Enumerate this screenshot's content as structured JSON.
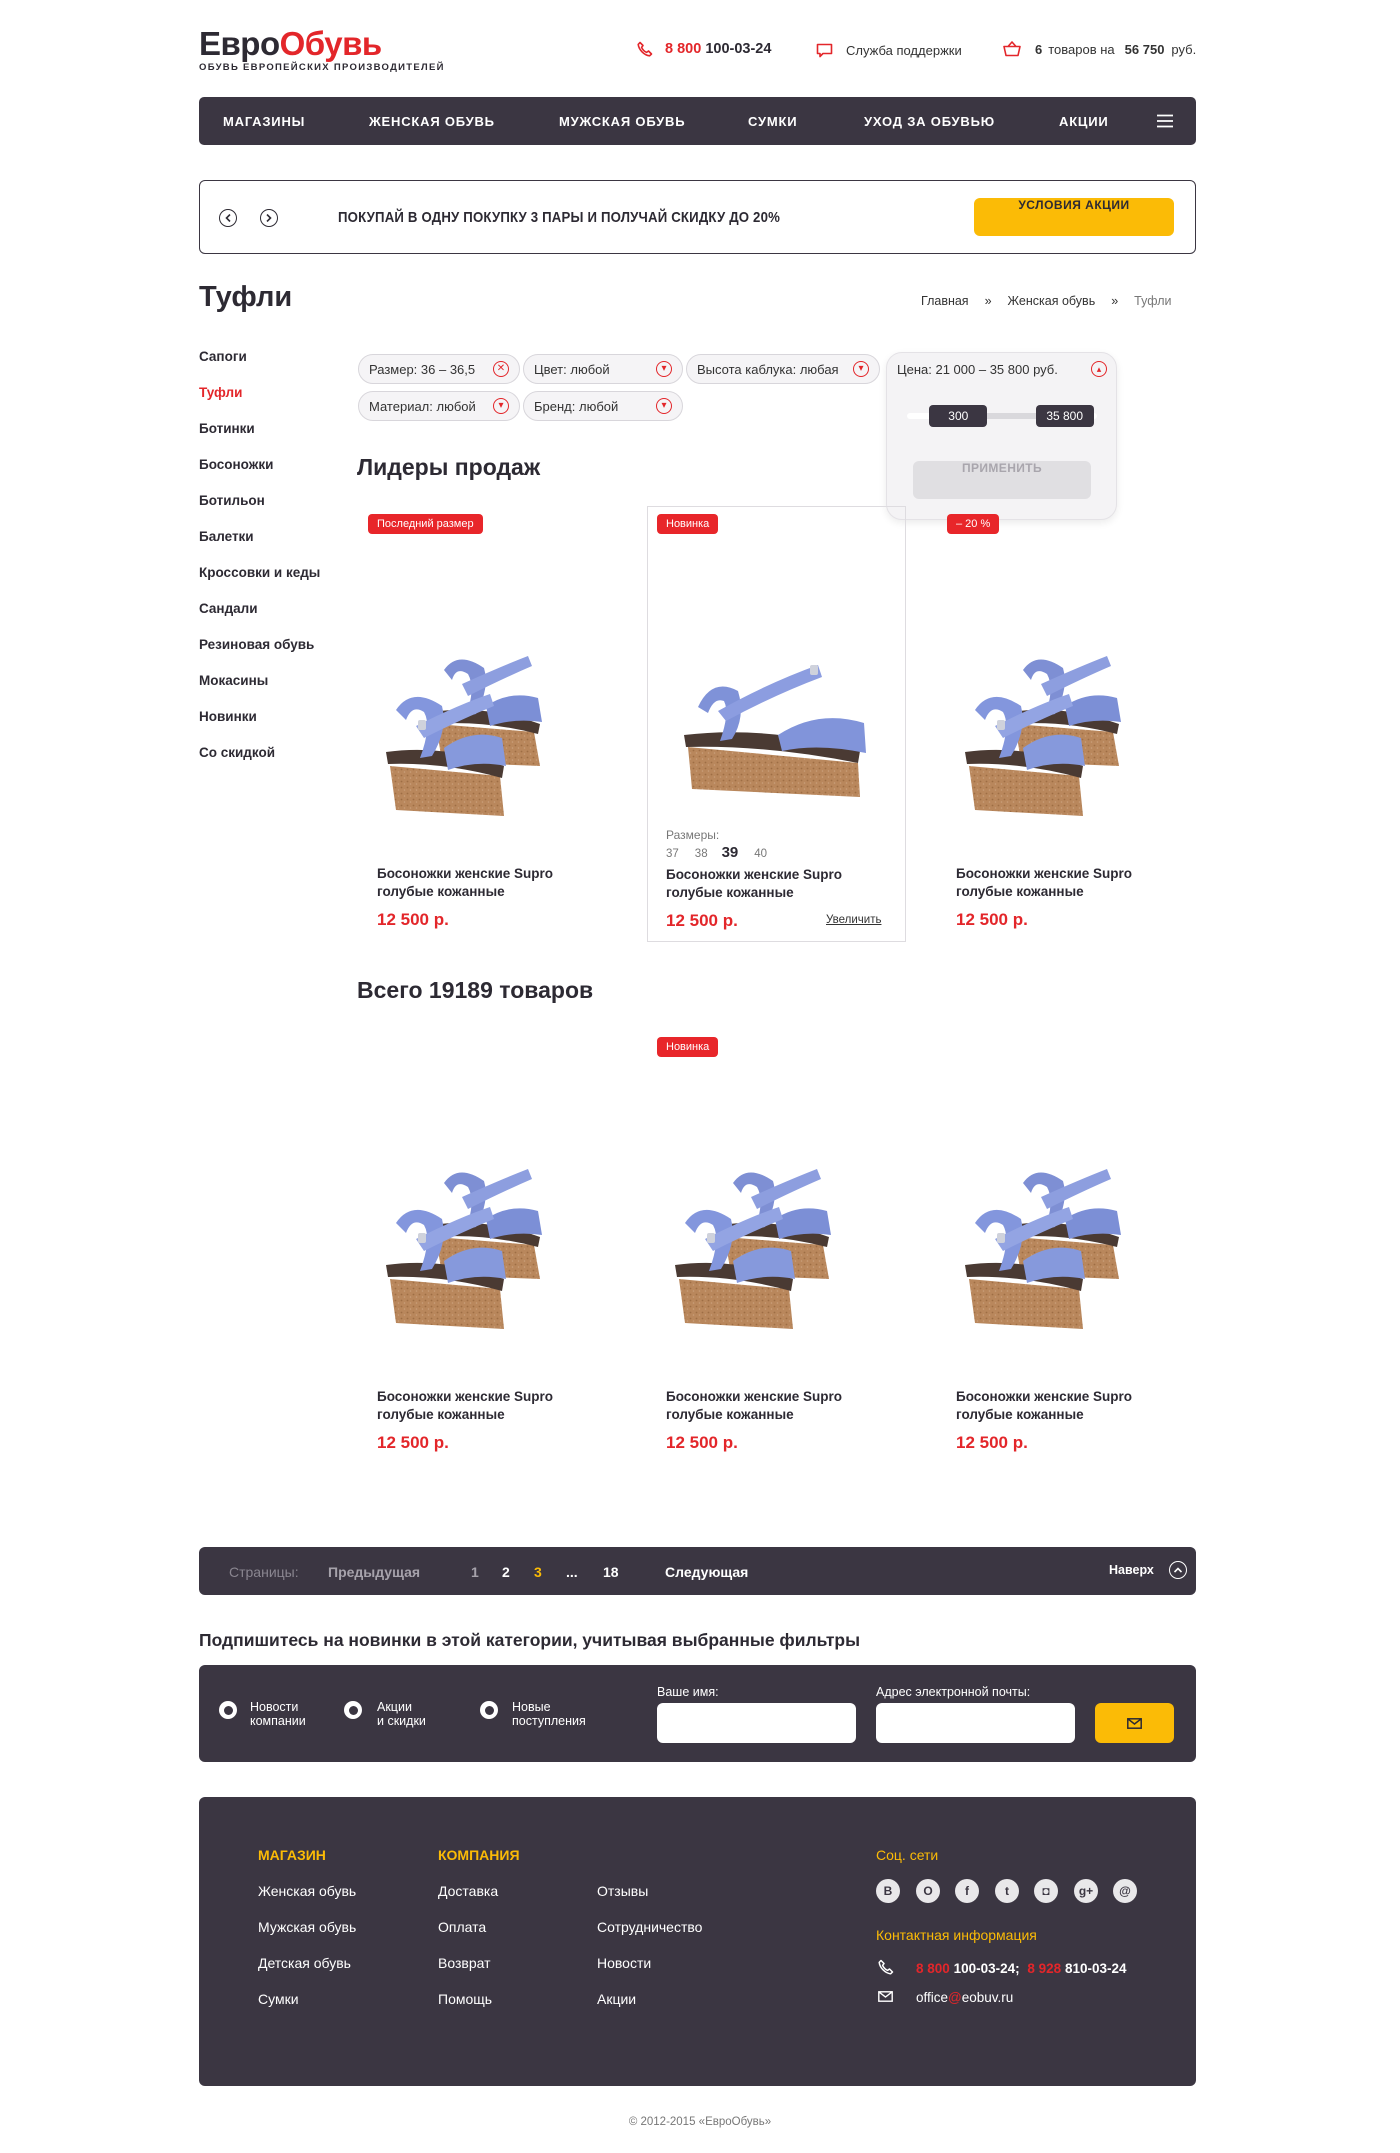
{
  "header": {
    "logo": {
      "part1": "Евро",
      "part2": "Обувь",
      "tagline": "Обувь европейских производителей"
    },
    "phone": {
      "prefix": "8 800",
      "number": "100-03-24"
    },
    "support": "Служба поддержки",
    "cart": {
      "count": "6",
      "text": "товаров на",
      "sum": "56 750",
      "currency": "руб."
    }
  },
  "nav": [
    "Магазины",
    "Женская обувь",
    "Мужская обувь",
    "Сумки",
    "Уход за обувью",
    "Акции"
  ],
  "promo": {
    "text": "ПОКУПАЙ В ОДНУ ПОКУПКУ 3 ПАРЫ И ПОЛУЧАЙ СКИДКУ ДО 20%",
    "button": "Условия акции"
  },
  "page_title": "Туфли",
  "breadcrumb": [
    "Главная",
    "Женская обувь",
    "Туфли"
  ],
  "breadcrumb_sep": "»",
  "sidebar": [
    {
      "label": "Сапоги",
      "active": false
    },
    {
      "label": "Туфли",
      "active": true
    },
    {
      "label": "Ботинки",
      "active": false
    },
    {
      "label": "Босоножки",
      "active": false
    },
    {
      "label": "Ботильон",
      "active": false
    },
    {
      "label": "Балетки",
      "active": false
    },
    {
      "label": "Кроссовки и кеды",
      "active": false
    },
    {
      "label": "Сандали",
      "active": false
    },
    {
      "label": "Резиновая обувь",
      "active": false
    },
    {
      "label": "Мокасины",
      "active": false
    },
    {
      "label": "Новинки",
      "active": false
    },
    {
      "label": "Со скидкой",
      "active": false
    }
  ],
  "filters": {
    "size": "Размер: 36 – 36,5",
    "color": "Цвет: любой",
    "heel": "Высота каблука: любая",
    "price": "Цена: 21 000 – 35 800 руб.",
    "material": "Материал: любой",
    "brand": "Бренд: любой",
    "price_popup": {
      "min": "300",
      "max": "35 800",
      "apply": "Применить",
      "range_low_fraction": 0.27,
      "range_high_fraction": 0.83
    }
  },
  "leaders": {
    "title": "Лидеры продаж",
    "products": [
      {
        "badge": "Последний размер",
        "name": "Босоножки женские Supro голубые кожанные",
        "price": "12 500 р."
      },
      {
        "badge": "Новинка",
        "name": "Босоножки женские Supro голубые кожанные",
        "price": "12 500 р.",
        "sizes_label": "Размеры:",
        "sizes": [
          "37",
          "38",
          "39",
          "40"
        ],
        "selected_size": "39",
        "zoom": "Увеличить"
      },
      {
        "badge": "– 20 %",
        "name": "Босоножки женские Supro голубые кожанные",
        "price": "12 500 р."
      }
    ]
  },
  "catalog": {
    "title": "Всего 19189 товаров",
    "products": [
      {
        "badge": "",
        "name": "Босоножки женские Supro голубые кожанные",
        "price": "12 500 р."
      },
      {
        "badge": "Новинка",
        "name": "Босоножки женские Supro голубые кожанные",
        "price": "12 500 р."
      },
      {
        "badge": "",
        "name": "Босоножки женские Supro голубые кожанные",
        "price": "12 500 р."
      }
    ]
  },
  "pagination": {
    "label": "Страницы:",
    "prev": "Предыдущая",
    "pages": [
      "1",
      "2",
      "3",
      "...",
      "18"
    ],
    "current": "3",
    "next": "Следующая",
    "top": "Наверх"
  },
  "subscribe": {
    "title": "Подпишитесь на новинки в этой категории, учитывая выбранные фильтры",
    "options": [
      [
        "Новости",
        "компании"
      ],
      [
        "Акции",
        "и скидки"
      ],
      [
        "Новые",
        "поступления"
      ]
    ],
    "name_label": "Ваше имя:",
    "email_label": "Адрес электронной почты:"
  },
  "footer": {
    "shop_title": "Магазин",
    "shop": [
      "Женская обувь",
      "Мужская обувь",
      "Детская обувь",
      "Сумки"
    ],
    "company_title": "Компания",
    "company1": [
      "Доставка",
      "Оплата",
      "Возврат",
      "Помощь"
    ],
    "company2": [
      "Отзывы",
      "Сотрудничество",
      "Новости",
      "Акции"
    ],
    "social_title": "Соц. сети",
    "social": [
      "В",
      "О",
      "f",
      "t",
      "◘",
      "g+",
      "@"
    ],
    "contact_title": "Контактная информация",
    "phone1_prefix": "8 800",
    "phone1": "100-03-24;",
    "phone2_prefix": "8 928",
    "phone2": "810-03-24",
    "email_user": "office",
    "email_at": "@",
    "email_domain": "eobuv.ru"
  },
  "copyright": "© 2012-2015 «ЕвроОбувь»"
}
